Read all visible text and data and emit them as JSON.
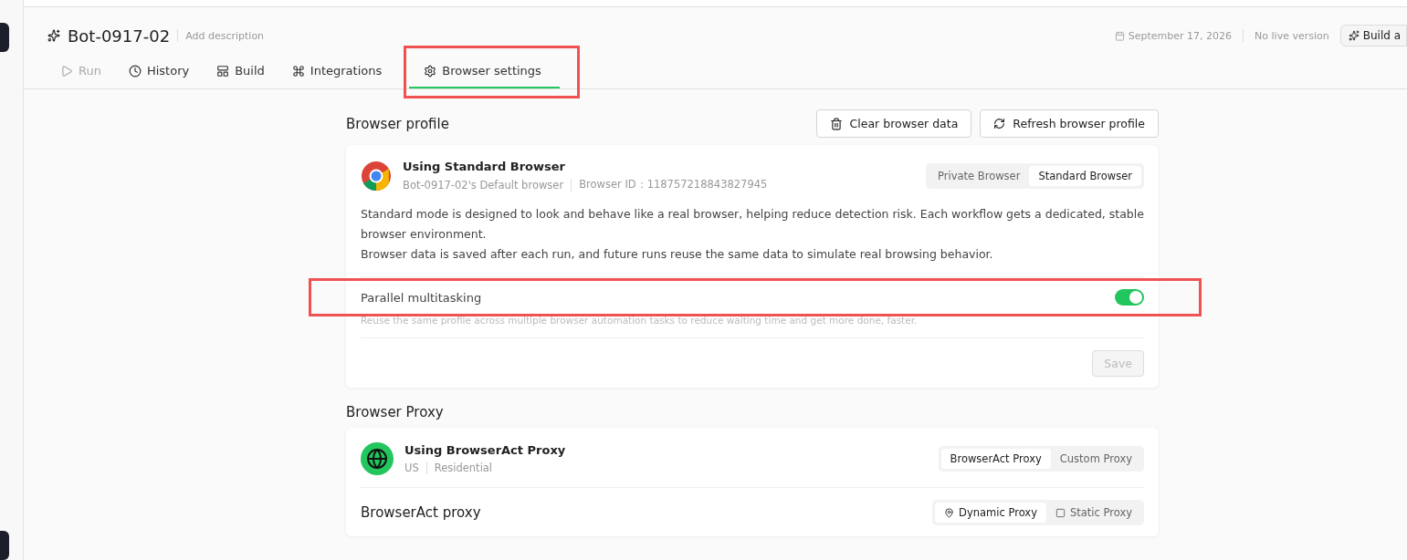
{
  "header": {
    "title": "Bot-0917-02",
    "description_placeholder": "Add description",
    "date": "September 17, 2026",
    "version": "No live version",
    "build_button": "Build a"
  },
  "tabs": [
    {
      "label": "Run",
      "selected": false,
      "disabled": true
    },
    {
      "label": "History",
      "selected": false,
      "disabled": false
    },
    {
      "label": "Build",
      "selected": false,
      "disabled": false
    },
    {
      "label": "Integrations",
      "selected": false,
      "disabled": false
    },
    {
      "label": "Browser settings",
      "selected": true,
      "disabled": false
    }
  ],
  "browser_profile": {
    "heading": "Browser profile",
    "actions": [
      "Clear browser data",
      "Refresh browser profile"
    ],
    "title": "Using Standard Browser",
    "default_browser": "Bot-0917-02's Default browser",
    "browser_id": "Browser ID：118757218843827945",
    "modes": [
      {
        "label": "Private Browser",
        "selected": false
      },
      {
        "label": "Standard Browser",
        "selected": true
      }
    ],
    "description": [
      "Standard mode is designed to look and behave like a real browser, helping reduce detection risk. Each workflow gets a dedicated, stable browser environment.",
      "Browser data is saved after each run, and future runs reuse the same data to simulate real browsing behavior."
    ],
    "parallel": {
      "label": "Parallel multitasking",
      "on": true,
      "hint": "Reuse the same profile across multiple browser automation tasks to reduce waiting time and get more done, faster."
    },
    "save": {
      "label": "Save",
      "disabled": true
    }
  },
  "browser_proxy": {
    "heading": "Browser Proxy",
    "title": "Using BrowserAct Proxy",
    "region": "US",
    "type": "Residential",
    "modes": [
      {
        "label": "BrowserAct Proxy",
        "selected": true
      },
      {
        "label": "Custom Proxy",
        "selected": false
      }
    ],
    "subheading": "BrowserAct proxy",
    "proxy_types": [
      {
        "label": "Dynamic Proxy",
        "selected": true
      },
      {
        "label": "Static Proxy",
        "selected": false
      }
    ]
  }
}
